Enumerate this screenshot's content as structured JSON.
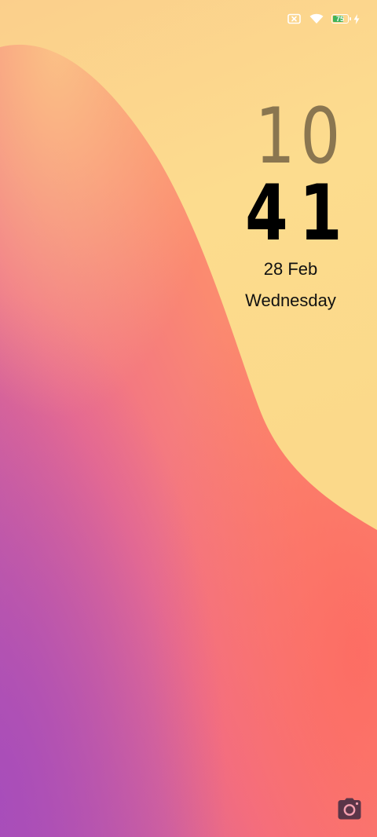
{
  "status_bar": {
    "sim_icon": "no-sim-icon",
    "wifi_icon": "wifi-icon",
    "battery_percent": 75,
    "battery_label": "75",
    "charging_icon": "charging-bolt-icon"
  },
  "lockscreen": {
    "hour": "10",
    "minute": "41",
    "date": "28 Feb",
    "weekday": "Wednesday"
  },
  "shortcuts": {
    "camera_icon": "camera-icon"
  },
  "colors": {
    "wallpaper_yellow": "#fbdf8c",
    "wallpaper_orange": "#fb8a70",
    "wallpaper_purple": "#b35aac",
    "hour_color": "#8a7650",
    "minute_color": "#000000",
    "battery_fill": "#3fb35a",
    "camera_icon_color": "#5a3548"
  }
}
